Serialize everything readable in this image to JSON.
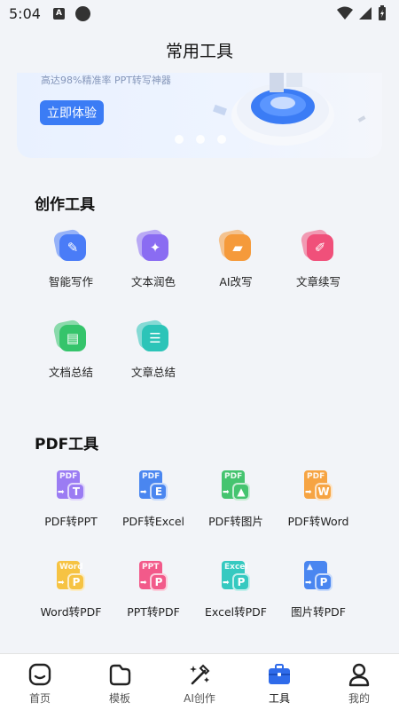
{
  "status": {
    "time": "5:04",
    "a_icon": "A"
  },
  "header": {
    "title": "常用工具"
  },
  "banner": {
    "subtitle": "高达98%精准率 PPT转写神器",
    "button": "立即体验",
    "accent": "#3b7cf5"
  },
  "creation": {
    "title": "创作工具",
    "items": [
      {
        "label": "智能写作",
        "color": "#4a7cf7",
        "icon": "pen-icon"
      },
      {
        "label": "文本润色",
        "color": "#8a6cf2",
        "icon": "magic-wand-icon"
      },
      {
        "label": "AI改写",
        "color": "#f59a3b",
        "icon": "eraser-icon"
      },
      {
        "label": "文章续写",
        "color": "#f0507a",
        "icon": "pencil-icon"
      },
      {
        "label": "文档总结",
        "color": "#35c46b",
        "icon": "document-icon"
      },
      {
        "label": "文章总结",
        "color": "#2cc4b8",
        "icon": "edit-list-icon"
      }
    ]
  },
  "pdf": {
    "title": "PDF工具",
    "items": [
      {
        "label": "PDF转PPT",
        "color": "#9b7cf3",
        "doc": "PDF",
        "badge": "T"
      },
      {
        "label": "PDF转Excel",
        "color": "#4a86f0",
        "doc": "PDF",
        "badge": "E"
      },
      {
        "label": "PDF转图片",
        "color": "#45c46f",
        "doc": "PDF",
        "badge": "▲"
      },
      {
        "label": "PDF转Word",
        "color": "#f6a443",
        "doc": "PDF",
        "badge": "W"
      },
      {
        "label": "Word转PDF",
        "color": "#f6c343",
        "doc": "Word",
        "badge": "P"
      },
      {
        "label": "PPT转PDF",
        "color": "#f25a8a",
        "doc": "PPT",
        "badge": "P"
      },
      {
        "label": "Excel转PDF",
        "color": "#35c9c0",
        "doc": "Excel",
        "badge": "P"
      },
      {
        "label": "图片转PDF",
        "color": "#4a86f0",
        "doc": "▲",
        "badge": "P"
      }
    ]
  },
  "nav": [
    {
      "label": "首页",
      "icon": "home-icon"
    },
    {
      "label": "模板",
      "icon": "folder-icon"
    },
    {
      "label": "AI创作",
      "icon": "ai-wand-icon"
    },
    {
      "label": "工具",
      "icon": "toolbox-icon",
      "active": true
    },
    {
      "label": "我的",
      "icon": "person-icon"
    }
  ]
}
